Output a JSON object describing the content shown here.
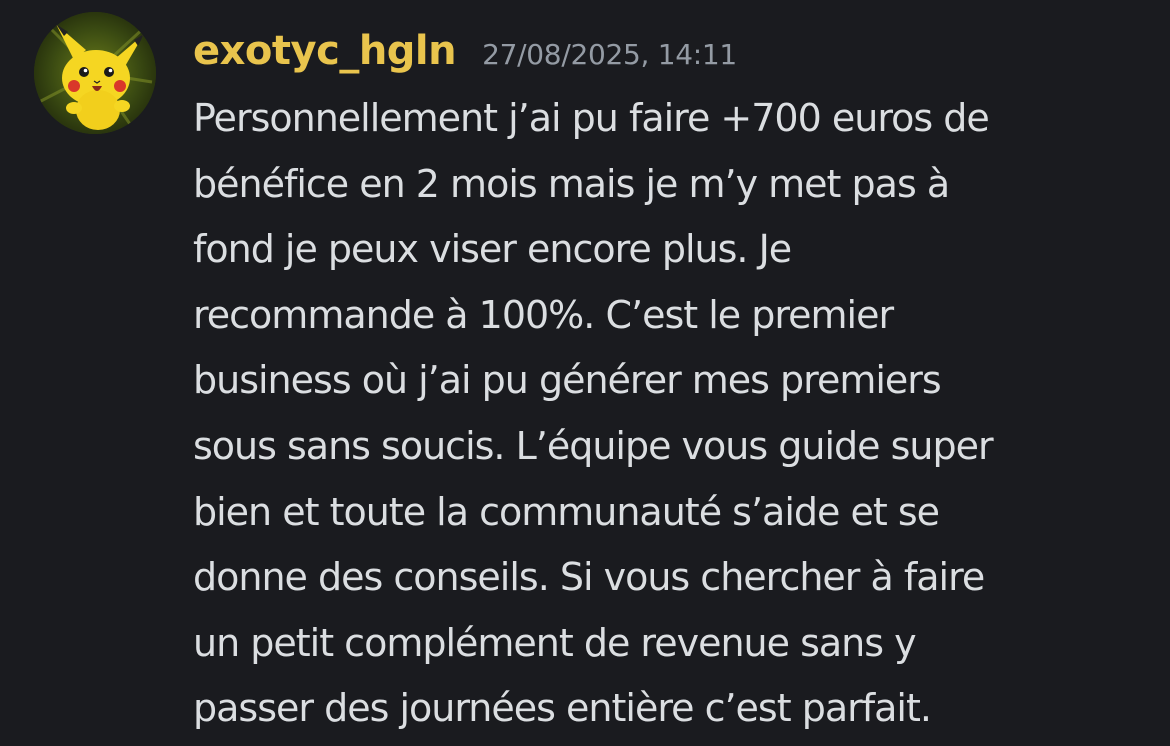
{
  "message": {
    "author": {
      "username": "exotyc_hgln",
      "avatar_icon": "pikachu-avatar-icon",
      "name_color": "#e9c44d"
    },
    "timestamp": "27/08/2025, 14:11",
    "text_lines": [
      "Personnellement j’ai pu faire +700 euros de",
      "bénéfice en 2 mois mais je m’y met pas à",
      "fond je peux viser encore plus. Je",
      "recommande à 100%. C’est le premier",
      "business où j’ai pu générer mes premiers",
      "sous sans soucis. L’équipe vous guide super",
      "bien et toute la communauté s’aide et se",
      "donne des conseils. Si vous chercher à faire",
      "un petit complément de revenue sans y",
      "passer des journées entière c’est parfait."
    ]
  },
  "colors": {
    "background": "#1a1b1f",
    "text": "#dbdee1",
    "timestamp": "#949ba4"
  }
}
